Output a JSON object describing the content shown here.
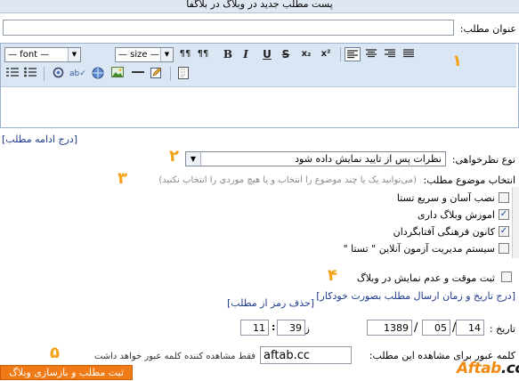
{
  "header": {
    "title": "پست مطلب جدید در وبلاگ در بلاگفا"
  },
  "post_title": {
    "label": "عنوان مطلب:",
    "value": ""
  },
  "editor": {
    "font_label": "— font —",
    "size_label": "— size —",
    "buttons": [
      "B",
      "I",
      "U",
      "S",
      "x₂",
      "x²"
    ],
    "callout_number": "۱"
  },
  "continue_link": "[درج ادامه مطلب]",
  "comments": {
    "label": "نوع نظرخواهی:",
    "selected": "نظرات پس از تایید نمایش داده شود",
    "callout_number": "۲"
  },
  "topics": {
    "label": "انتخاب موضوع مطلب:",
    "hint": "(می‌توانید یک یا چند موضوع را انتخاب و یا هیچ موردی را انتخاب نکنید)",
    "callout_number": "۳",
    "items": [
      {
        "label": "نصب آسان و سریع تستا",
        "checked": false
      },
      {
        "label": "اموزش وبلاگ داری",
        "checked": true
      },
      {
        "label": "کانون فرهنگی آفتابگردان",
        "checked": true
      },
      {
        "label": "سیستم مدیریت آزمون آنلاین \" تستا \"",
        "checked": false
      }
    ]
  },
  "draft": {
    "label": "ثبت موقت و عدم نمایش در وبلاگ",
    "callout_number": "۴"
  },
  "schedule": {
    "link": "[درج تاریخ و زمان ارسال مطلب بصورت خودکار]",
    "remove_password_link": "[حذف رمز از مطلب]",
    "date_label": "تاریخ :",
    "day": "14",
    "month": "05",
    "year": "1389",
    "time_label": "زمان:",
    "minute": "39",
    "hour": "11"
  },
  "password": {
    "label": "کلمه عبور برای مشاهده این مطلب:",
    "value": "aftab.cc",
    "hint": "فقط مشاهده کننده کلمه عبور خواهد داشت",
    "callout_number": "۵"
  },
  "submit_label": "ثبت مطلب و بازسازی وبلاگ",
  "watermark": {
    "text": "Aftab",
    "tld": ".cc"
  },
  "colors": {
    "accent": "#f4a21a",
    "link": "#1f3a8a",
    "toolbar": "#dbe6f4",
    "button": "#f07b16"
  }
}
